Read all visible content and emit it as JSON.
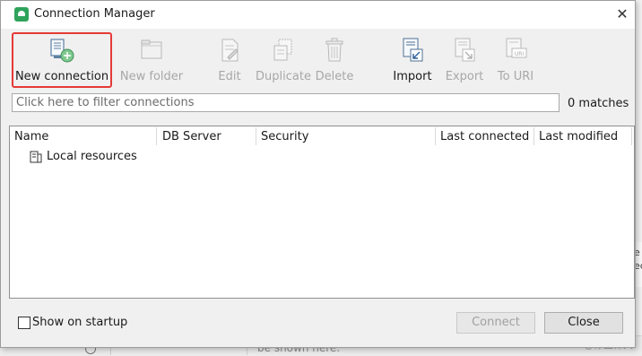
{
  "background": {
    "bottom_text": "be shown here.",
    "right_chars": [
      "e",
      "ec"
    ],
    "watermark": "CSDN @你宣伟大"
  },
  "dialog": {
    "title": "Connection Manager",
    "close_glyph": "✕"
  },
  "toolbar": {
    "new_connection": "New connection",
    "new_folder": "New folder",
    "edit": "Edit",
    "duplicate": "Duplicate",
    "delete": "Delete",
    "import": "Import",
    "export": "Export",
    "to_uri": "To URI"
  },
  "filter": {
    "placeholder": "Click here to filter connections",
    "matches": "0 matches"
  },
  "table": {
    "columns": [
      "Name",
      "DB Server",
      "Security",
      "Last connected",
      "Last modified"
    ],
    "rows": [
      {
        "name": "Local resources"
      }
    ]
  },
  "footer": {
    "show_on_startup": "Show on startup",
    "show_on_startup_checked": false,
    "connect": "Connect",
    "close": "Close"
  },
  "colors": {
    "highlight": "#e53a36",
    "brand": "#2fa35b"
  }
}
